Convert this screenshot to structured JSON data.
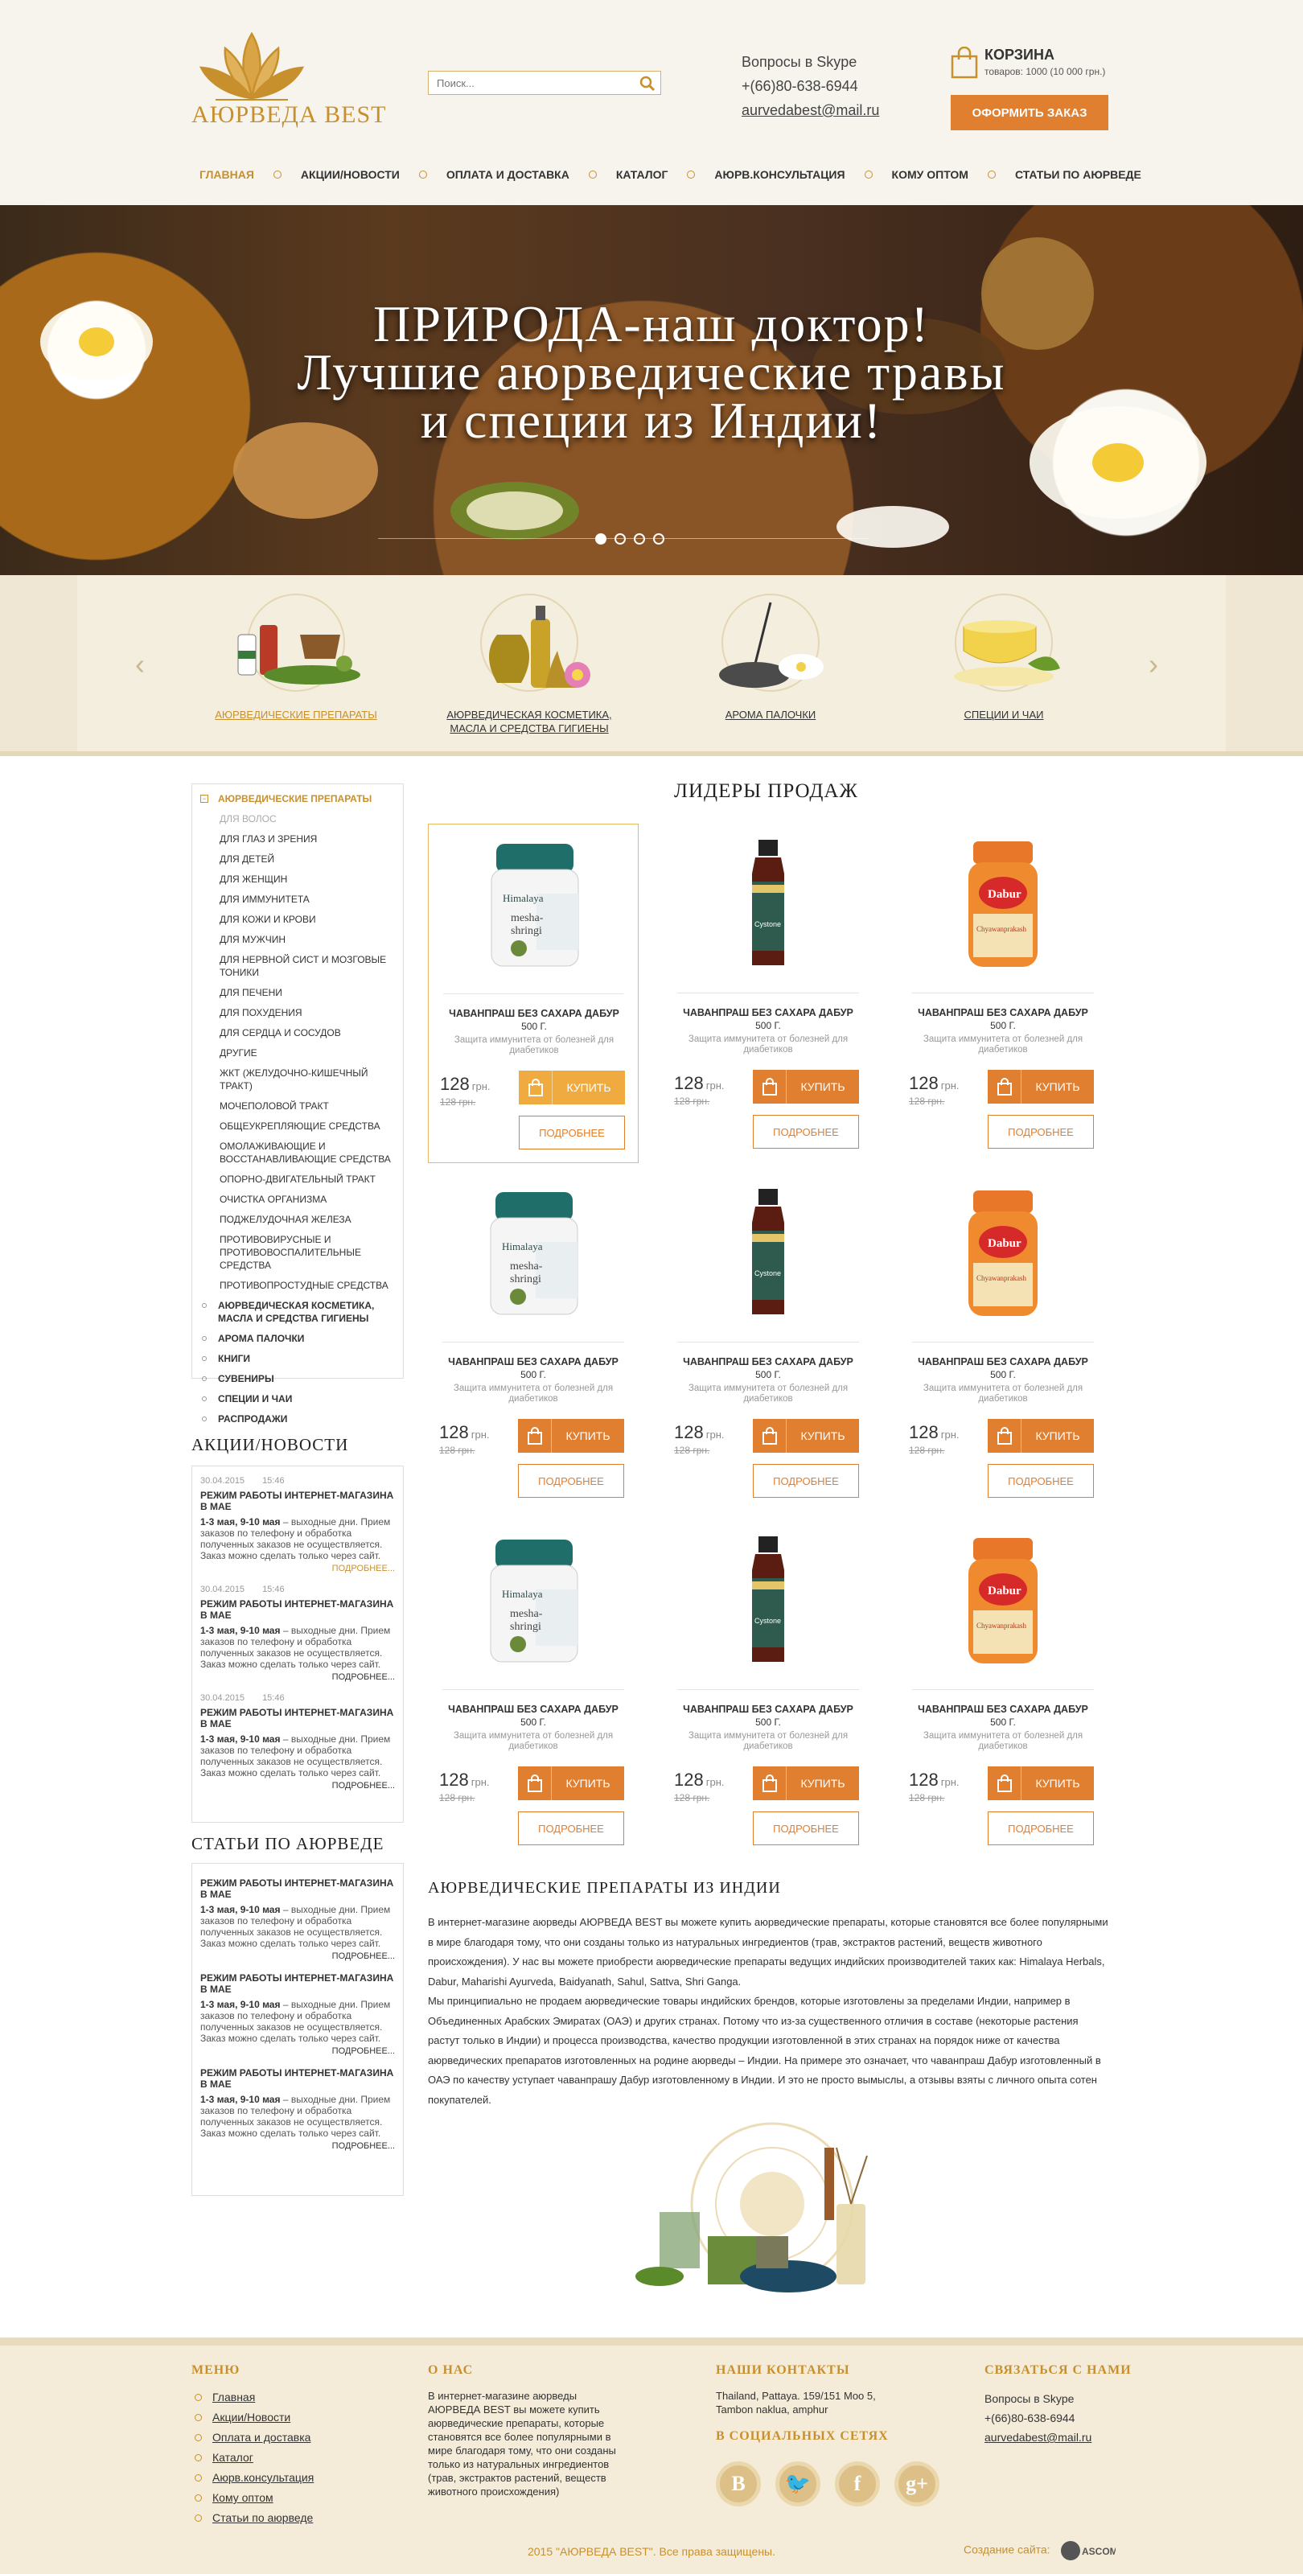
{
  "header": {
    "logo_text": "АЮРВЕДА BEST",
    "search_placeholder": "Поиск...",
    "skype_label": "Вопросы в Skype",
    "phone": "+(66)80-638-6944",
    "email": "aurvedabest@mail.ru",
    "cart_title": "КОРЗИНА",
    "cart_summary": "товаров: 1000 (10 000 грн.)",
    "order_button": "ОФОРМИТЬ ЗАКАЗ"
  },
  "nav": {
    "items": [
      {
        "label": "ГЛАВНАЯ"
      },
      {
        "label": "АКЦИИ/НОВОСТИ"
      },
      {
        "label": "ОПЛАТА И ДОСТАВКА"
      },
      {
        "label": "КАТАЛОГ"
      },
      {
        "label": "АЮРВ.КОНСУЛЬТАЦИЯ"
      },
      {
        "label": "КОМУ ОПТОМ"
      },
      {
        "label": "СТАТЬИ ПО АЮРВЕДЕ"
      }
    ]
  },
  "hero": {
    "title": "ПРИРОДА-наш доктор!\nЛучшие аюрведические травы\nи специи из Индии!",
    "active_slide": 1,
    "slides": 4
  },
  "categories": [
    {
      "label": "АЮРВЕДИЧЕСКИЕ ПРЕПАРАТЫ"
    },
    {
      "label": "АЮРВЕДИЧЕСКАЯ КОСМЕТИКА, МАСЛА И СРЕДСТВА ГИГИЕНЫ"
    },
    {
      "label": "АРОМА ПАЛОЧКИ"
    },
    {
      "label": "СПЕЦИИ И ЧАИ"
    }
  ],
  "sidebar": {
    "open_category": "АЮРВЕДИЧЕСКИЕ ПРЕПАРАТЫ",
    "subitems": [
      "ДЛЯ ВОЛОС",
      "ДЛЯ ГЛАЗ И ЗРЕНИЯ",
      "ДЛЯ ДЕТЕЙ",
      "ДЛЯ ЖЕНЩИН",
      "ДЛЯ ИММУНИТЕТА",
      "ДЛЯ КОЖИ И КРОВИ",
      "ДЛЯ МУЖЧИН",
      "ДЛЯ НЕРВНОЙ СИСТ И МОЗГОВЫЕ ТОНИКИ",
      "ДЛЯ ПЕЧЕНИ",
      "ДЛЯ ПОХУДЕНИЯ",
      "ДЛЯ СЕРДЦА И СОСУДОВ",
      "ДРУГИЕ",
      "ЖКТ (желудочно-кишечный тракт)",
      "МОЧЕПОЛОВОЙ ТРАКТ",
      "ОБЩЕУКРЕПЛЯЮЩИЕ СРЕДСТВА",
      "ОМОЛАЖИВАЮЩИЕ И ВОССТАНАВЛИВАЮЩИЕ СРЕДСТВА",
      "ОПОРНО-ДВИГАТЕЛЬНЫЙ ТРАКТ",
      "ОЧИСТКА ОРГАНИЗМА",
      "ПОДЖЕЛУДОЧНАЯ ЖЕЛЕЗА",
      "ПРОТИВОВИРУСНЫЕ И ПРОТИВОВОСПАЛИТЕЛЬНЫЕ СРЕДСТВА",
      "ПРОТИВОПРОСТУДНЫЕ СРЕДСТВА"
    ],
    "other_categories": [
      "АЮРВЕДИЧЕСКАЯ КОСМЕТИКА, МАСЛА И СРЕДСТВА ГИГИЕНЫ",
      "АРОМА ПАЛОЧКИ",
      "КНИГИ",
      "СУВЕНИРЫ",
      "СПЕЦИИ И ЧАИ",
      "РАСПРОДАЖИ"
    ]
  },
  "news": {
    "title": "АКЦИИ/НОВОСТИ",
    "items": [
      {
        "date": "30.04.2015",
        "time": "15:46",
        "headline": "РЕЖИМ РАБОТЫ ИНТЕРНЕТ-МАГАЗИНА В МАЕ",
        "bold": "1-3 мая, 9-10 мая",
        "body": " – выходные дни. Прием заказов по телефону и обработка полученных заказов не осуществляется. Заказ можно сделать только через сайт.",
        "more": "ПОДРОБНЕЕ..."
      },
      {
        "date": "30.04.2015",
        "time": "15:46",
        "headline": "РЕЖИМ РАБОТЫ ИНТЕРНЕТ-МАГАЗИНА В МАЕ",
        "bold": "1-3 мая, 9-10 мая",
        "body": " – выходные дни. Прием заказов по телефону и обработка полученных заказов не осуществляется. Заказ можно сделать только через сайт.",
        "more": "ПОДРОБНЕЕ..."
      },
      {
        "date": "30.04.2015",
        "time": "15:46",
        "headline": "РЕЖИМ РАБОТЫ ИНТЕРНЕТ-МАГАЗИНА В МАЕ",
        "bold": "1-3 мая, 9-10 мая",
        "body": " – выходные дни. Прием заказов по телефону и обработка полученных заказов не осуществляется. Заказ можно сделать только через сайт.",
        "more": "ПОДРОБНЕЕ..."
      }
    ]
  },
  "articles": {
    "title": "СТАТЬИ ПО АЮРВЕДЕ",
    "items": [
      {
        "headline": "Режим работы интернет-магазина в мае",
        "bold": "1-3 мая, 9-10 мая",
        "body": " – выходные дни. Прием заказов по телефону и обработка полученных заказов не осуществляется. Заказ можно сделать только через сайт.",
        "more": "ПОДРОБНЕЕ..."
      },
      {
        "headline": "Режим работы интернет-магазина в мае",
        "bold": "1-3 мая, 9-10 мая",
        "body": " – выходные дни. Прием заказов по телефону и обработка полученных заказов не осуществляется. Заказ можно сделать только через сайт.",
        "more": "ПОДРОБНЕЕ..."
      },
      {
        "headline": "Режим работы интернет-магазина в мае",
        "bold": "1-3 мая, 9-10 мая",
        "body": " – выходные дни. Прием заказов по телефону и обработка полученных заказов не осуществляется. Заказ можно сделать только через сайт.",
        "more": "ПОДРОБНЕЕ..."
      }
    ]
  },
  "bestsellers": {
    "title": "ЛИДЕРЫ ПРОДАЖ",
    "products": [
      {
        "kind": "himalaya",
        "name": "ЧАВАНПРАШ БЕЗ САХАРА ДАБУР",
        "weight": "500 Г.",
        "desc": "Защита иммунитета от болезней для диабетиков",
        "price": "128",
        "currency": "грн.",
        "old_price": "128 грн.",
        "buy": "КУПИТЬ",
        "more": "ПОДРОБНЕЕ"
      },
      {
        "kind": "cystone",
        "name": "ЧАВАНПРАШ БЕЗ САХАРА ДАБУР",
        "weight": "500 Г.",
        "desc": "Защита иммунитета от болезней для диабетиков",
        "price": "128",
        "currency": "грн.",
        "old_price": "128 грн.",
        "buy": "КУПИТЬ",
        "more": "ПОДРОБНЕЕ"
      },
      {
        "kind": "dabur",
        "name": "ЧАВАНПРАШ БЕЗ САХАРА ДАБУР",
        "weight": "500 Г.",
        "desc": "Защита иммунитета от болезней для диабетиков",
        "price": "128",
        "currency": "грн.",
        "old_price": "128 грн.",
        "buy": "КУПИТЬ",
        "more": "ПОДРОБНЕЕ"
      },
      {
        "kind": "himalaya",
        "name": "ЧАВАНПРАШ БЕЗ САХАРА ДАБУР",
        "weight": "500 Г.",
        "desc": "Защита иммунитета от болезней для диабетиков",
        "price": "128",
        "currency": "грн.",
        "old_price": "128 грн.",
        "buy": "КУПИТЬ",
        "more": "ПОДРОБНЕЕ"
      },
      {
        "kind": "cystone",
        "name": "ЧАВАНПРАШ БЕЗ САХАРА ДАБУР",
        "weight": "500 Г.",
        "desc": "Защита иммунитета от болезней для диабетиков",
        "price": "128",
        "currency": "грн.",
        "old_price": "128 грн.",
        "buy": "КУПИТЬ",
        "more": "ПОДРОБНЕЕ"
      },
      {
        "kind": "dabur",
        "name": "ЧАВАНПРАШ БЕЗ САХАРА ДАБУР",
        "weight": "500 Г.",
        "desc": "Защита иммунитета от болезней для диабетиков",
        "price": "128",
        "currency": "грн.",
        "old_price": "128 грн.",
        "buy": "КУПИТЬ",
        "more": "ПОДРОБНЕЕ"
      },
      {
        "kind": "himalaya",
        "name": "ЧАВАНПРАШ БЕЗ САХАРА ДАБУР",
        "weight": "500 Г.",
        "desc": "Защита иммунитета от болезней для диабетиков",
        "price": "128",
        "currency": "грн.",
        "old_price": "128 грн.",
        "buy": "КУПИТЬ",
        "more": "ПОДРОБНЕЕ"
      },
      {
        "kind": "cystone",
        "name": "ЧАВАНПРАШ БЕЗ САХАРА ДАБУР",
        "weight": "500 Г.",
        "desc": "Защита иммунитета от болезней для диабетиков",
        "price": "128",
        "currency": "грн.",
        "old_price": "128 грн.",
        "buy": "КУПИТЬ",
        "more": "ПОДРОБНЕЕ"
      },
      {
        "kind": "dabur",
        "name": "ЧАВАНПРАШ БЕЗ САХАРА ДАБУР",
        "weight": "500 Г.",
        "desc": "Защита иммунитета от болезней для диабетиков",
        "price": "128",
        "currency": "грн.",
        "old_price": "128 грн.",
        "buy": "КУПИТЬ",
        "more": "ПОДРОБНЕЕ"
      }
    ],
    "highlighted_index": 0
  },
  "about": {
    "title": "АЮРВЕДИЧЕСКИЕ ПРЕПАРАТЫ ИЗ ИНДИИ",
    "paragraphs": [
      " В интернет-магазине аюрведы АЮРВЕДА BEST вы можете купить аюрведические препараты, которые становятся все более популярными в мире благодаря тому, что они созданы только из натуральных ингредиентов (трав, экстрактов растений, веществ животного происхождения). У нас вы можете приобрести аюрведические препараты ведущих индийских производителей таких как: Himalaya Herbals, Dabur, Maharishi Ayurveda, Baidyanath, Sahul, Sattva, Shri Ganga.",
      " Мы принципиально не продаем аюрведические товары индийских брендов, которые изготовлены за пределами Индии, например в Объединенных Арабских Эмиратах (ОАЭ) и других странах. Потому что из-за существенного отличия в составе (некоторые растения растут только в Индии) и процесса производства, качество продукции изготовленной в этих странах на порядок ниже от качества аюрведических препаратов изготовленных на родине аюрведы – Индии. На примере это означает, что чаванпраш Дабур изготовленный в ОАЭ по качеству уступает чаванпрашу Дабур изготовленному в Индии. И это не просто вымыслы, а отзывы взяты с личного опыта сотен покупателей."
    ]
  },
  "footer": {
    "menu_title": "МЕНЮ",
    "menu": [
      "Главная",
      "Акции/Новости",
      "Оплата и доставка",
      "Каталог",
      "Аюрв.консультация",
      "Кому оптом",
      "Статьи по аюрведе"
    ],
    "about_title": "О НАС",
    "about_text": "В интернет-магазине аюрведы АЮРВЕДА BEST вы можете купить аюрведические препараты, которые становятся все более популярными в мире благодаря тому, что они созданы только из натуральных ингредиентов (трав, экстрактов растений, веществ животного происхождения)",
    "contacts_title": "НАШИ КОНТАКТЫ",
    "address": "Thailand, Pattaya. 159/151 Moo 5, Tambon naklua, amphur",
    "social_title": "В СОЦИАЛЬНЫХ СЕТЯХ",
    "socials": [
      {
        "icon": "vk-icon",
        "glyph": "В"
      },
      {
        "icon": "twitter-icon",
        "glyph": "🐦"
      },
      {
        "icon": "facebook-icon",
        "glyph": "f"
      },
      {
        "icon": "google-plus-icon",
        "glyph": "g+"
      }
    ],
    "connect_title": "СВЯЗАТЬСЯ С НАМИ",
    "skype_label": "Вопросы в Skype",
    "phone": "+(66)80-638-6944",
    "email": "aurvedabest@mail.ru",
    "copyright": "2015 \"АЮРВЕДА BEST\". Все права защищены.",
    "credit": "Создание сайта:"
  },
  "colors": {
    "accent": "#e07f2f",
    "gold": "#c8902c",
    "cream": "#f4ecd9"
  }
}
